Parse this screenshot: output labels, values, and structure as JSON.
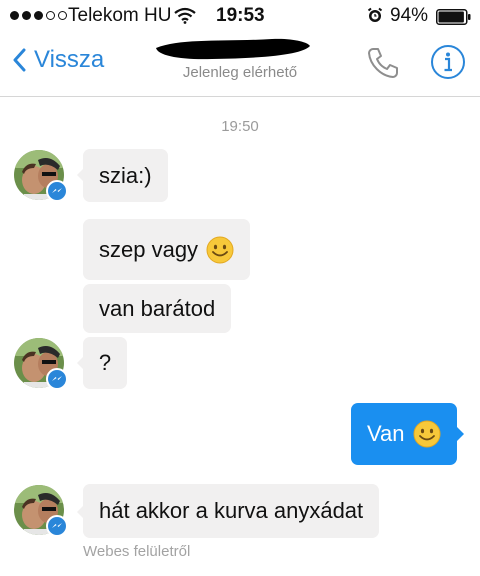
{
  "status_bar": {
    "carrier": "Telekom HU",
    "time": "19:53",
    "battery_percent": "94%",
    "signal_bars": 3,
    "signal_total": 5,
    "battery_level": 0.94
  },
  "nav": {
    "back_label": "Vissza",
    "status": "Jelenleg elérhető"
  },
  "conversation": {
    "timestamp": "19:50",
    "messages": [
      {
        "from": "contact",
        "text": "szia:)"
      },
      {
        "from": "contact",
        "text": "szep vagy",
        "emoji": "smiling-face-icon"
      },
      {
        "from": "contact",
        "text": "van barátod"
      },
      {
        "from": "contact",
        "text": "?"
      },
      {
        "from": "me",
        "text": "Van",
        "emoji": "smiling-face-icon"
      },
      {
        "from": "contact",
        "text": "hát akkor a kurva anyxádat"
      }
    ],
    "source": "Webes felületről"
  },
  "colors": {
    "accent": "#2a86d9",
    "outgoing_bubble": "#1a8ff0",
    "incoming_bubble": "#f1f0f0"
  }
}
